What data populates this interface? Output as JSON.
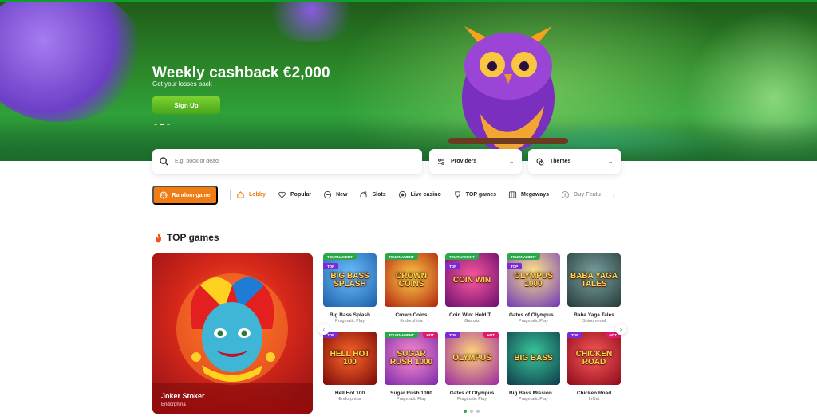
{
  "hero": {
    "title": "Weekly cashback €2,000",
    "subtitle": "Get your losses back",
    "cta_label": "Sign Up",
    "slides_count": 3,
    "active_slide": 2
  },
  "search": {
    "placeholder": "E.g. book of dead"
  },
  "filters": {
    "providers_label": "Providers",
    "themes_label": "Themes"
  },
  "random_game_label": "Random game",
  "categories": [
    {
      "label": "Lobby",
      "icon": "home-icon",
      "active": true
    },
    {
      "label": "Popular",
      "icon": "heart-icon"
    },
    {
      "label": "New",
      "icon": "new-icon"
    },
    {
      "label": "Slots",
      "icon": "slots-icon"
    },
    {
      "label": "Live casino",
      "icon": "live-icon"
    },
    {
      "label": "TOP games",
      "icon": "trophy-icon"
    },
    {
      "label": "Megaways",
      "icon": "megaways-icon"
    },
    {
      "label": "Buy Featu",
      "icon": "buy-icon"
    }
  ],
  "section": {
    "title": "TOP games",
    "icon": "fire-icon"
  },
  "featured": {
    "name": "Joker Stoker",
    "provider": "Endorphina"
  },
  "games": [
    {
      "name": "Big Bass Splash",
      "provider": "Pragmatic Play",
      "badges": [
        "TOURNAMENT",
        "TOP"
      ],
      "art": "BIG BASS SPLASH"
    },
    {
      "name": "Crown Coins",
      "provider": "Endorphina",
      "badges": [
        "TOURNAMENT"
      ],
      "art": "CROWN COINS"
    },
    {
      "name": "Coin Win: Hold T...",
      "provider": "Gamzix",
      "badges": [
        "TOURNAMENT",
        "TOP"
      ],
      "art": "COIN WIN"
    },
    {
      "name": "Gates of Olympus...",
      "provider": "Pragmatic Play",
      "badges": [
        "TOURNAMENT",
        "TOP"
      ],
      "art": "OLYMPUS 1000"
    },
    {
      "name": "Baba Yaga Tales",
      "provider": "Spinomenal",
      "badges": [],
      "art": "BABA YAGA TALES"
    },
    {
      "name": "Hell Hot 100",
      "provider": "Endorphina",
      "badges": [
        "TOP"
      ],
      "art": "HELL HOT 100"
    },
    {
      "name": "Sugar Rush 1000",
      "provider": "Pragmatic Play",
      "badges": [
        "TOURNAMENT",
        "HOT"
      ],
      "art": "SUGAR RUSH 1000"
    },
    {
      "name": "Gates of Olympus",
      "provider": "Pragmatic Play",
      "badges": [
        "TOP",
        "HOT"
      ],
      "art": "OLYMPUS"
    },
    {
      "name": "Big Bass Mission ...",
      "provider": "Pragmatic Play",
      "badges": [],
      "art": "BIG BASS"
    },
    {
      "name": "Chicken Road",
      "provider": "InOut",
      "badges": [
        "TOP",
        "HOT"
      ],
      "art": "CHICKEN ROAD"
    }
  ],
  "pager": {
    "pages": 3,
    "active": 1
  },
  "colors": {
    "brand_green": "#2aa84a",
    "accent_orange": "#f07c13",
    "top_purple": "#7a2bd6",
    "hot_pink": "#e0196b"
  }
}
